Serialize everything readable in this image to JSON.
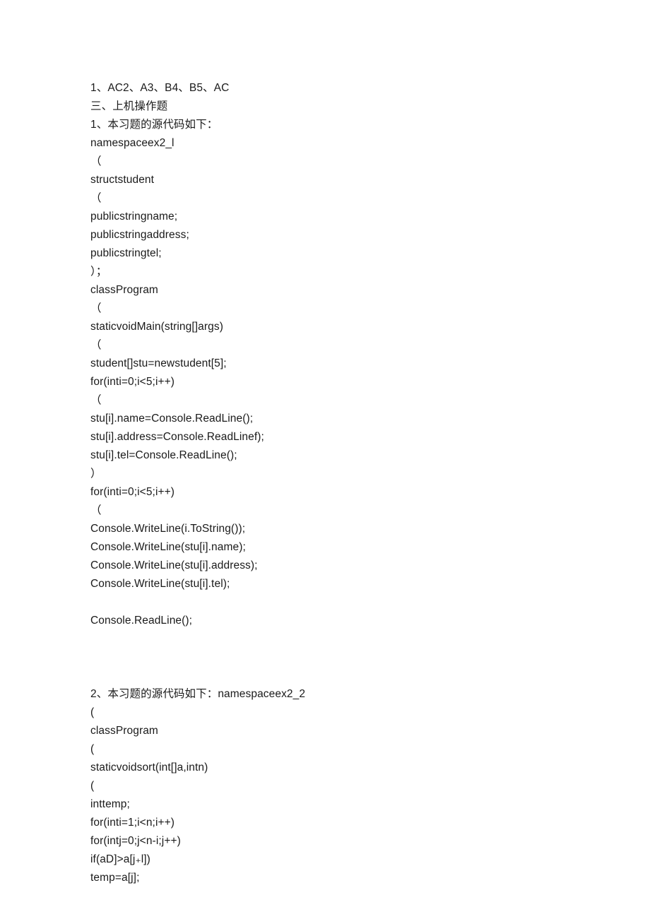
{
  "lines": [
    "1、AC2、A3、B4、B5、AC",
    "三、上机操作题",
    "1、本习题的源代码如下：",
    "namespaceex2_l",
    "（",
    "structstudent",
    "（",
    "publicstringname;",
    "publicstringaddress;",
    "publicstringtel;",
    "）；",
    "classProgram",
    "（",
    "staticvoidMain(string[]args)",
    "（",
    "student[]stu=newstudent[5];",
    "for(inti=0;i<5;i++)",
    "（",
    "stu[i].name=Console.ReadLine();",
    "stu[i].address=Console.ReadLinef);",
    "stu[i].tel=Console.ReadLine();",
    "）",
    "for(inti=0;i<5;i++)",
    "（",
    "Console.WriteLine(i.ToString());",
    "Console.WriteLine(stu[i].name);",
    "Console.WriteLine(stu[i].address);",
    "Console.WriteLine(stu[i].tel);",
    "",
    "Console.ReadLine();",
    "",
    "",
    "",
    "2、本习题的源代码如下：namespaceex2_2",
    "(",
    "classProgram",
    "(",
    "staticvoidsort(int[]a,intn)",
    "(",
    "inttemp;",
    "for(inti=1;i<n;i++)",
    "for(intj=0;j<n-i;j++)",
    "if(aD]>a[j₊l])",
    "temp=a[j];"
  ]
}
